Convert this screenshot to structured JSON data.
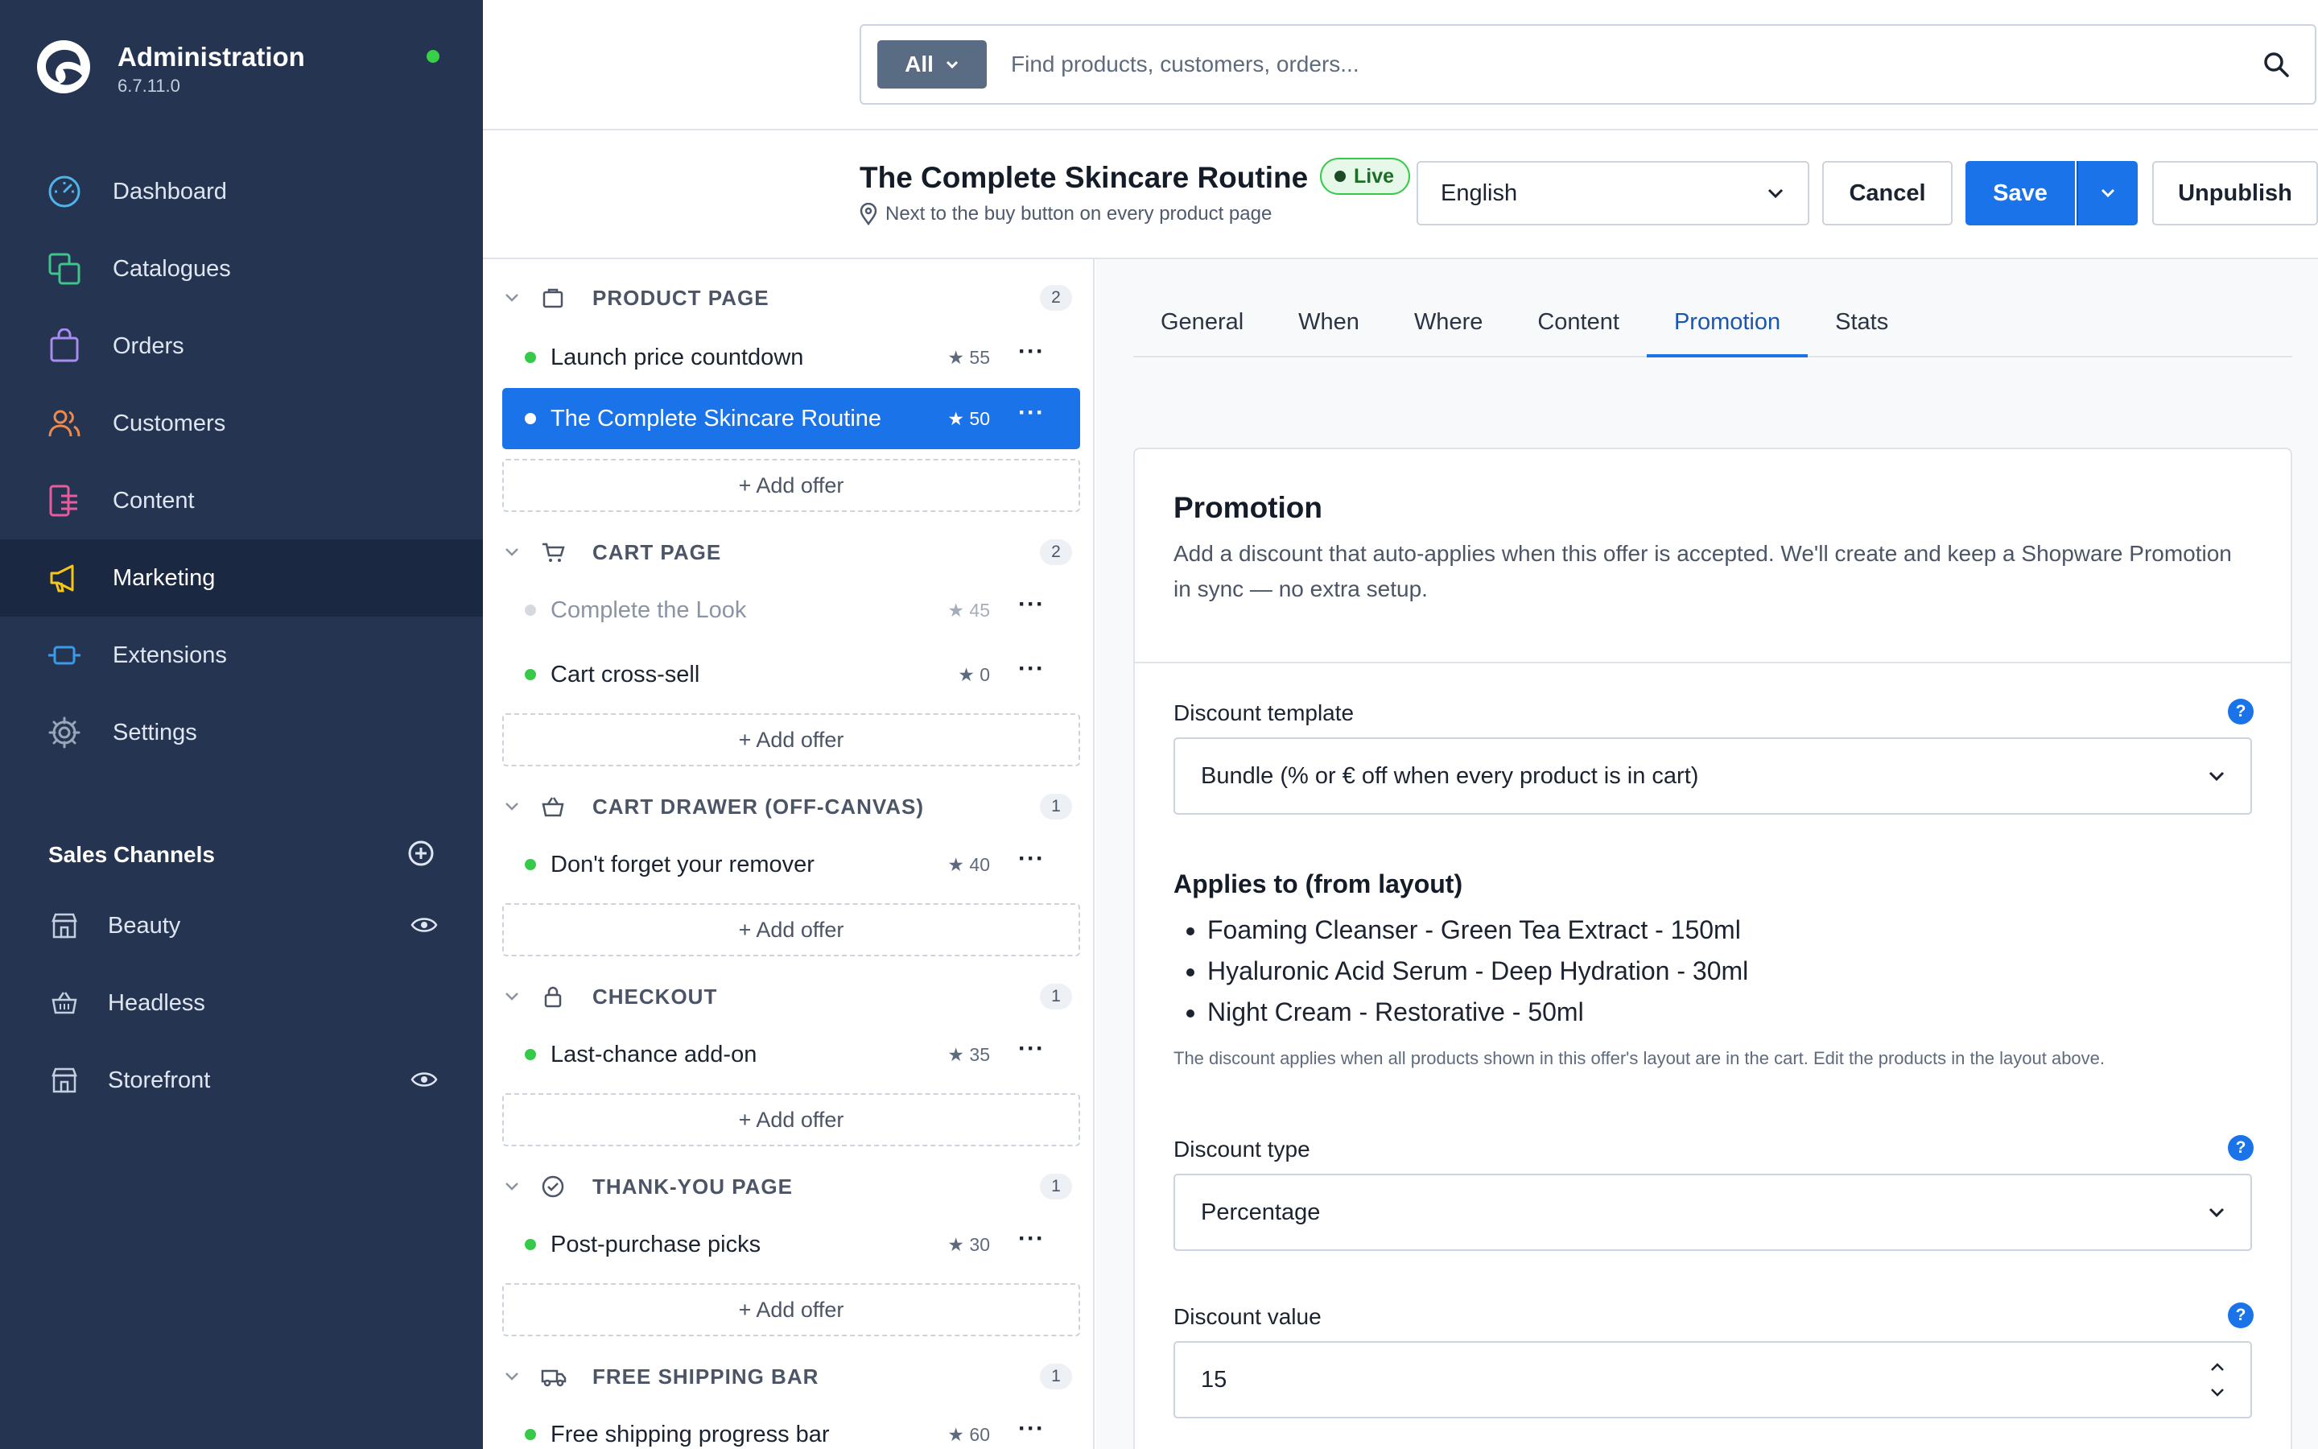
{
  "app": {
    "title": "Administration",
    "version": "6.7.11.0",
    "status_color": "#37d046"
  },
  "nav": {
    "items": [
      {
        "label": "Dashboard",
        "icon": "dashboard-icon",
        "color": "#4fb3e8"
      },
      {
        "label": "Catalogues",
        "icon": "catalogues-icon",
        "color": "#3fc48a"
      },
      {
        "label": "Orders",
        "icon": "orders-icon",
        "color": "#a98cf0"
      },
      {
        "label": "Customers",
        "icon": "customers-icon",
        "color": "#f08a4b"
      },
      {
        "label": "Content",
        "icon": "content-icon",
        "color": "#e85c9c"
      },
      {
        "label": "Marketing",
        "icon": "marketing-icon",
        "color": "#f5c518",
        "active": true
      },
      {
        "label": "Extensions",
        "icon": "extensions-icon",
        "color": "#3a9bea"
      },
      {
        "label": "Settings",
        "icon": "settings-icon",
        "color": "#9aa6b8"
      }
    ]
  },
  "sales_channels": {
    "title": "Sales Channels",
    "items": [
      {
        "label": "Beauty",
        "icon": "storefront-icon",
        "visible_icon": true
      },
      {
        "label": "Headless",
        "icon": "basket-icon",
        "visible_icon": false
      },
      {
        "label": "Storefront",
        "icon": "storefront-icon",
        "visible_icon": true
      }
    ]
  },
  "search": {
    "scope": "All",
    "placeholder": "Find products, customers, orders..."
  },
  "header": {
    "title": "The Complete Skincare Routine",
    "badge": "Live",
    "subtitle": "Next to the buy button on every product page",
    "language": "English",
    "cancel": "Cancel",
    "save": "Save",
    "unpublish": "Unpublish"
  },
  "groups": [
    {
      "title": "PRODUCT PAGE",
      "count": "2",
      "icon": "product-page-icon",
      "offers": [
        {
          "name": "Launch price countdown",
          "score": "★ 55",
          "state": "active"
        },
        {
          "name": "The Complete Skincare Routine",
          "score": "★ 50",
          "state": "selected"
        }
      ]
    },
    {
      "title": "CART PAGE",
      "count": "2",
      "icon": "cart-icon",
      "offers": [
        {
          "name": "Complete the Look",
          "score": "★ 45",
          "state": "inactive"
        },
        {
          "name": "Cart cross-sell",
          "score": "★ 0",
          "state": "active"
        }
      ]
    },
    {
      "title": "CART DRAWER (OFF-CANVAS)",
      "count": "1",
      "icon": "basket-icon",
      "offers": [
        {
          "name": "Don't forget your remover",
          "score": "★ 40",
          "state": "active"
        }
      ]
    },
    {
      "title": "CHECKOUT",
      "count": "1",
      "icon": "lock-icon",
      "offers": [
        {
          "name": "Last-chance add-on",
          "score": "★ 35",
          "state": "active"
        }
      ]
    },
    {
      "title": "THANK-YOU PAGE",
      "count": "1",
      "icon": "check-circle-icon",
      "offers": [
        {
          "name": "Post-purchase picks",
          "score": "★ 30",
          "state": "active"
        }
      ]
    },
    {
      "title": "FREE SHIPPING BAR",
      "count": "1",
      "icon": "truck-icon",
      "offers": [
        {
          "name": "Free shipping progress bar",
          "score": "★ 60",
          "state": "active"
        }
      ]
    }
  ],
  "add_offer_label": "+ Add offer",
  "more_label": "···",
  "tabs": [
    "General",
    "When",
    "Where",
    "Content",
    "Promotion",
    "Stats"
  ],
  "active_tab": "Promotion",
  "promotion": {
    "title": "Promotion",
    "description": "Add a discount that auto-applies when this offer is accepted. We'll create and keep a Shopware Promotion in sync — no extra setup.",
    "discount_template_label": "Discount template",
    "discount_template_value": "Bundle (% or € off when every product is in cart)",
    "applies_title": "Applies to (from layout)",
    "applies_items": [
      "Foaming Cleanser - Green Tea Extract - 150ml",
      "Hyaluronic Acid Serum - Deep Hydration - 30ml",
      "Night Cream - Restorative - 50ml"
    ],
    "hint": "The discount applies when all products shown in this offer's layout are in the cart. Edit the products in the layout above.",
    "discount_type_label": "Discount type",
    "discount_type_value": "Percentage",
    "discount_value_label": "Discount value",
    "discount_value": "15",
    "help": "?"
  },
  "colors": {
    "sidebar": "#253551",
    "accent": "#1a73e8",
    "live": "#37c94a"
  }
}
